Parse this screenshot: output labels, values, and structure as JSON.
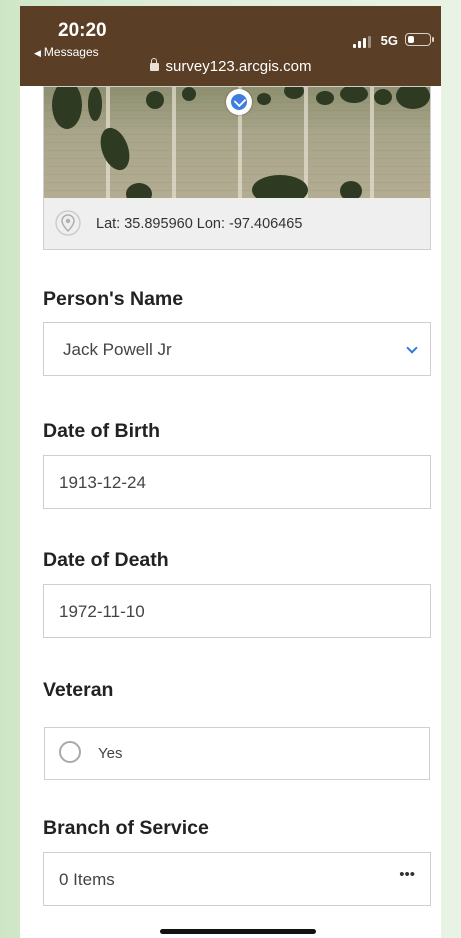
{
  "status": {
    "time": "20:20",
    "back_label": "Messages",
    "network": "5G",
    "url": "survey123.arcgis.com"
  },
  "map": {
    "coords": "Lat: 35.895960  Lon: -97.406465"
  },
  "form": {
    "person_name": {
      "label": "Person's Name",
      "value": "Jack Powell Jr"
    },
    "date_of_birth": {
      "label": "Date of Birth",
      "value": "1913-12-24"
    },
    "date_of_death": {
      "label": "Date of Death",
      "value": "1972-11-10"
    },
    "veteran": {
      "label": "Veteran",
      "option": "Yes"
    },
    "branch": {
      "label": "Branch of Service",
      "value": "0 Items",
      "more": "•••"
    }
  },
  "colors": {
    "statusbar": "#5a3e26",
    "accent": "#2f7bd6"
  }
}
